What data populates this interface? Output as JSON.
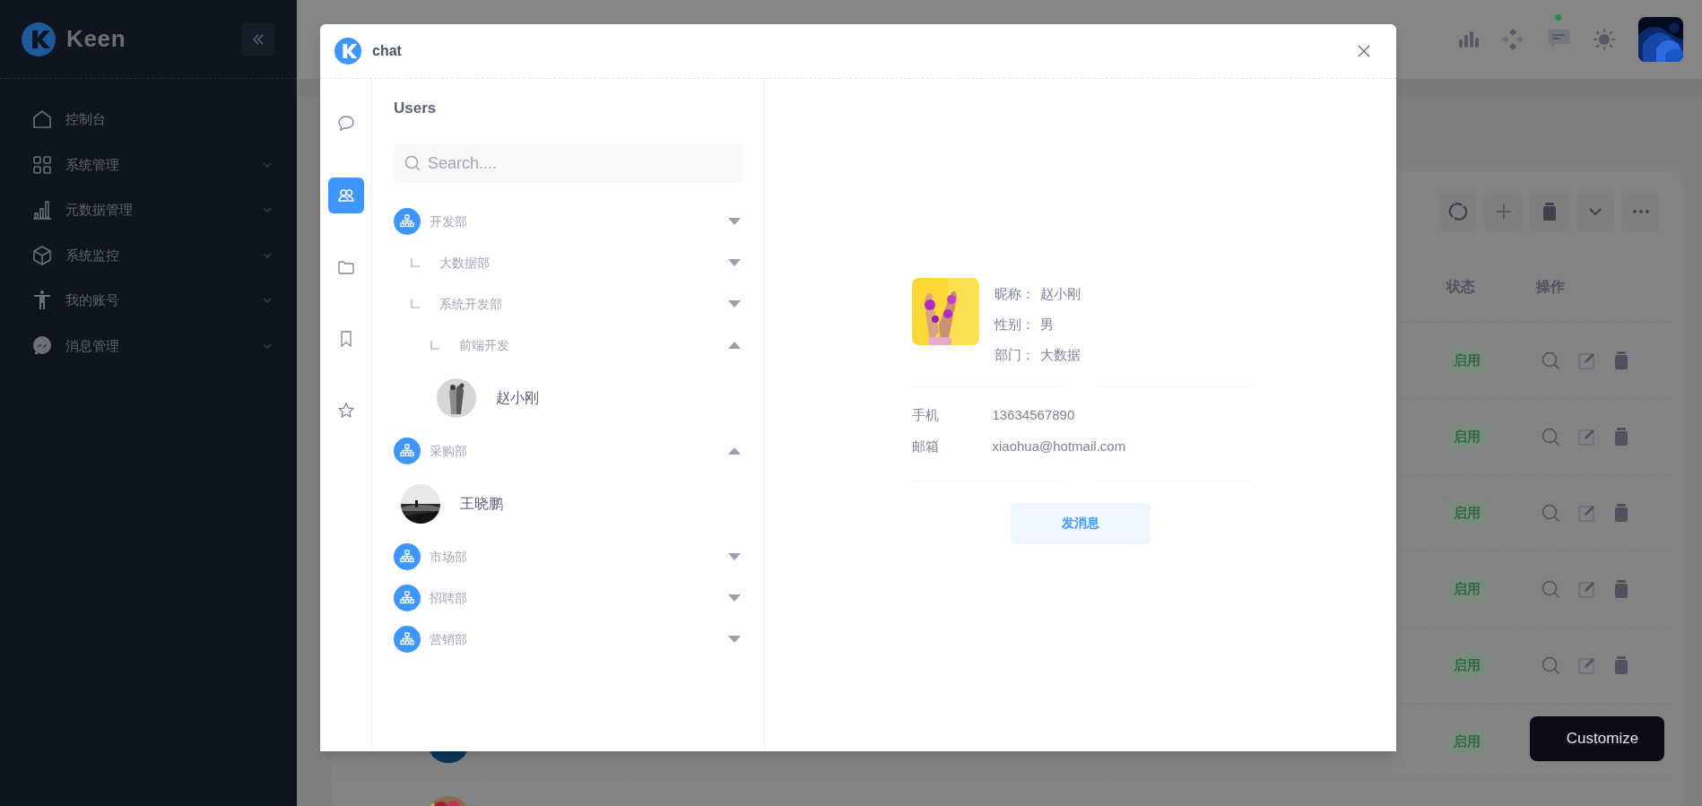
{
  "sidebar": {
    "brand": "Keen",
    "menu": [
      {
        "kind": "home",
        "label": "控制台",
        "submenu": false
      },
      {
        "kind": "grid",
        "label": "系统管理",
        "submenu": true
      },
      {
        "kind": "bars",
        "label": "元数据管理",
        "submenu": true
      },
      {
        "kind": "cube",
        "label": "系统监控",
        "submenu": true
      },
      {
        "kind": "person",
        "label": "我的账号",
        "submenu": true
      },
      {
        "kind": "messenger",
        "label": "消息管理",
        "submenu": true
      }
    ]
  },
  "header": {
    "chat_unread": true
  },
  "table": {
    "columns": [
      "状态",
      "操作"
    ],
    "rows": [
      {
        "status": "启用",
        "actions": true
      },
      {
        "status": "启用",
        "actions": true
      },
      {
        "status": "启用",
        "actions": true
      },
      {
        "status": "启用",
        "actions": true
      },
      {
        "status": "启用",
        "actions": true
      },
      {
        "status": "启用",
        "avatar": {
          "kind": "picture"
        }
      },
      {
        "avatar": {
          "kind": "picture"
        }
      }
    ]
  },
  "customize_button": "Customize",
  "modal": {
    "title": "chat",
    "rail": [
      {
        "kind": "chat",
        "selected": false
      },
      {
        "kind": "users",
        "selected": true
      },
      {
        "kind": "folder",
        "selected": false
      },
      {
        "kind": "bookmark",
        "selected": false
      },
      {
        "kind": "star",
        "selected": false
      }
    ],
    "users_panel": {
      "title": "Users",
      "search": {
        "placeholder": "Search...."
      },
      "tree": [
        {
          "kind": "department",
          "label": "开发部",
          "expanded": false,
          "children": [
            {
              "kind": "department",
              "label": "大数据部",
              "expanded": false
            },
            {
              "kind": "department",
              "label": "系统开发部",
              "expanded": false,
              "children": [
                {
                  "kind": "department",
                  "label": "前端开发",
                  "expanded": true,
                  "children": [
                    {
                      "kind": "user",
                      "name": "赵小刚"
                    }
                  ]
                }
              ]
            }
          ]
        },
        {
          "kind": "department",
          "label": "采购部",
          "expanded": true,
          "children": [
            {
              "kind": "user",
              "name": "王晓鹏"
            }
          ]
        },
        {
          "kind": "department",
          "label": "市场部",
          "expanded": false
        },
        {
          "kind": "department",
          "label": "招聘部",
          "expanded": false
        },
        {
          "kind": "department",
          "label": "营销部",
          "expanded": false
        }
      ]
    },
    "profile": {
      "fields": [
        {
          "label": "昵称：",
          "value": "赵小刚"
        },
        {
          "label": "性别：",
          "value": "男"
        },
        {
          "label": "部门：",
          "value": "大数据"
        }
      ],
      "contacts": [
        {
          "label": "手机",
          "value": "13634567890"
        },
        {
          "label": "邮箱",
          "value": "xiaohua@hotmail.com"
        }
      ],
      "button": "发消息"
    }
  }
}
